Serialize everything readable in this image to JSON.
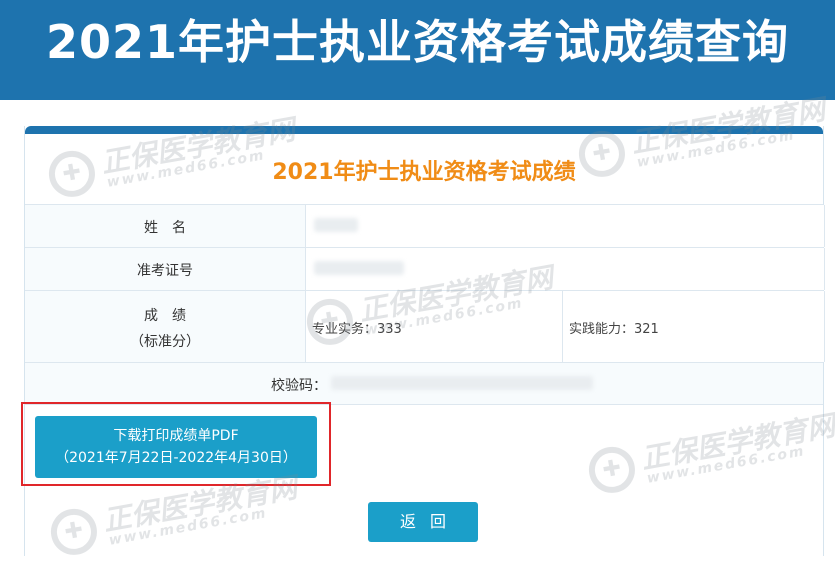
{
  "banner": {
    "title": "2021年护士执业资格考试成绩查询"
  },
  "panel": {
    "title": "2021年护士执业资格考试成绩",
    "rows": {
      "name_label": "姓　名",
      "ticket_label": "准考证号",
      "score_label_line1": "成　绩",
      "score_label_line2": "（标准分）",
      "score_professional": "专业实务：333",
      "score_practical": "实践能力：321",
      "verify_label": "校验码："
    },
    "download_button": {
      "line1": "下载打印成绩单PDF",
      "line2": "（2021年7月22日-2022年4月30日）"
    },
    "back_button": "返回"
  },
  "watermark": {
    "name": "正保医学教育网",
    "url": "www.med66.com",
    "icon": "medical-cross-logo-icon"
  },
  "colors": {
    "banner": "#1e73ae",
    "title_orange": "#f08c16",
    "button": "#1b9fc9",
    "highlight_red": "#e0262a"
  }
}
